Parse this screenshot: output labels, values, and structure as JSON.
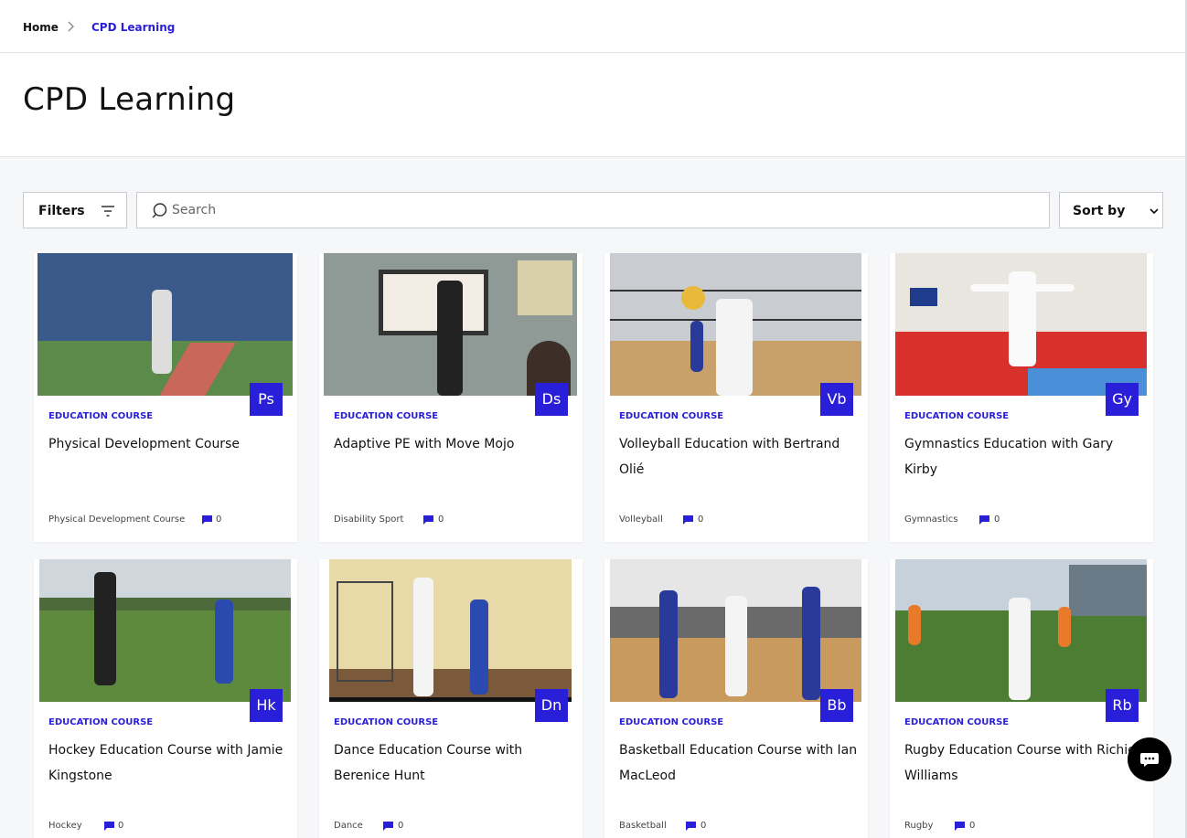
{
  "breadcrumb": {
    "home": "Home",
    "current": "CPD Learning"
  },
  "page": {
    "title": "CPD Learning"
  },
  "toolbar": {
    "filters_label": "Filters",
    "search_placeholder": "Search",
    "sort_label": "Sort by"
  },
  "colors": {
    "accent": "#2a1fd8"
  },
  "icons": {
    "breadcrumb_separator": "chevron-right-icon",
    "filters": "filter-lines-icon",
    "search": "search-icon",
    "sort": "chevron-down-icon",
    "comments": "comment-icon",
    "chat": "chat-bubble-icon"
  },
  "courses": [
    {
      "badge": "Ps",
      "category": "EDUCATION COURSE",
      "title": "Physical Development Course",
      "sport": "Physical Development Course",
      "comments": "0"
    },
    {
      "badge": "Ds",
      "category": "EDUCATION COURSE",
      "title": "Adaptive PE with Move Mojo",
      "sport": "Disability Sport",
      "comments": "0"
    },
    {
      "badge": "Vb",
      "category": "EDUCATION COURSE",
      "title": "Volleyball Education with Bertrand Olié",
      "sport": "Volleyball",
      "comments": "0"
    },
    {
      "badge": "Gy",
      "category": "EDUCATION COURSE",
      "title": "Gymnastics Education with Gary Kirby",
      "sport": "Gymnastics",
      "comments": "0"
    },
    {
      "badge": "Hk",
      "category": "EDUCATION COURSE",
      "title": "Hockey Education Course with Jamie Kingstone",
      "sport": "Hockey",
      "comments": "0"
    },
    {
      "badge": "Dn",
      "category": "EDUCATION COURSE",
      "title": "Dance Education Course with Berenice Hunt",
      "sport": "Dance",
      "comments": "0"
    },
    {
      "badge": "Bb",
      "category": "EDUCATION COURSE",
      "title": "Basketball Education Course with Ian MacLeod",
      "sport": "Basketball",
      "comments": "0"
    },
    {
      "badge": "Rb",
      "category": "EDUCATION COURSE",
      "title": "Rugby Education Course with Richie Williams",
      "sport": "Rugby",
      "comments": "0"
    }
  ]
}
